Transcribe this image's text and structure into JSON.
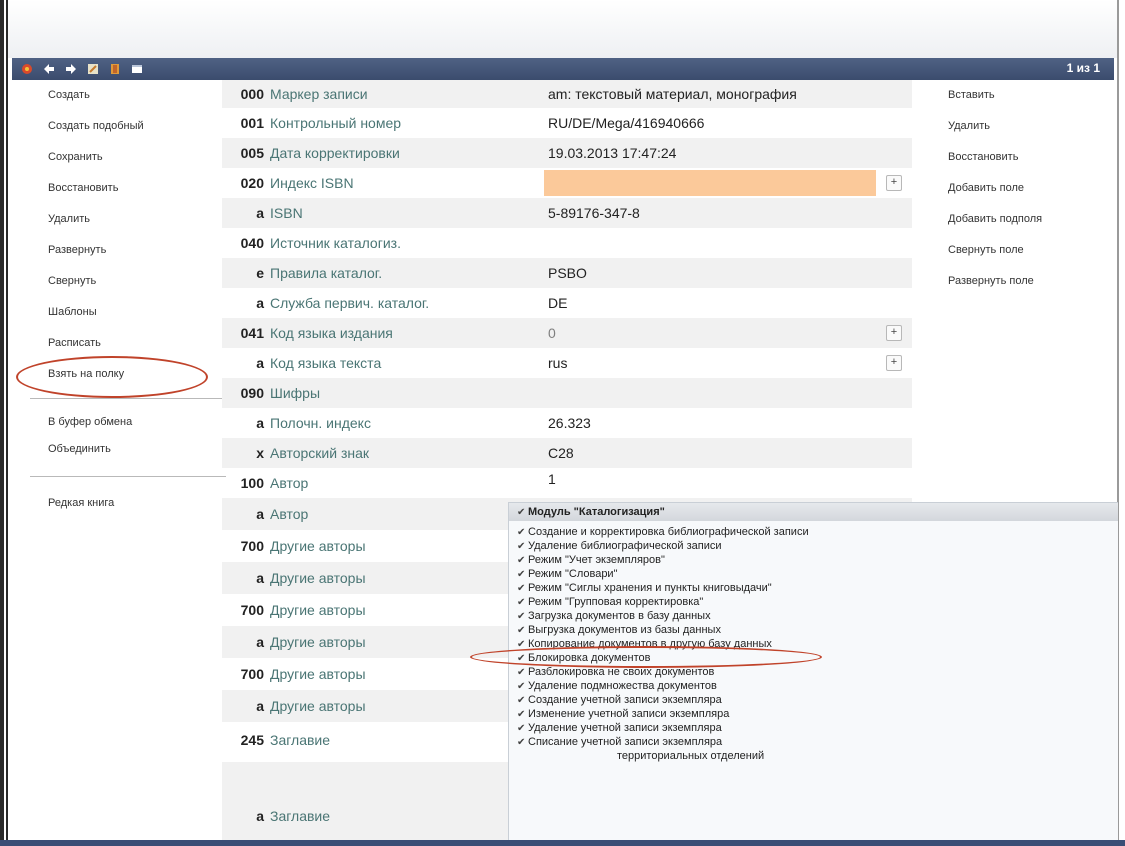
{
  "toolbar": {
    "icons": [
      "app-logo-icon",
      "arrow-left-icon",
      "arrow-right-icon",
      "edit-icon",
      "book-icon",
      "window-icon"
    ],
    "record_counter": "1 из 1"
  },
  "left_menu": {
    "items": [
      "Создать",
      "Создать подобный",
      "Сохранить",
      "Восстановить",
      "Удалить",
      "Развернуть",
      "Свернуть",
      "Шаблоны",
      "Расписать",
      "Взять на полку"
    ],
    "group2": [
      "В буфер обмена",
      "Объединить"
    ],
    "group3": [
      "Редкая книга"
    ]
  },
  "right_menu": {
    "items": [
      "Вставить",
      "Удалить",
      "Восстановить",
      "Добавить поле",
      "Добавить подполя",
      "Свернуть поле",
      "Развернуть поле"
    ]
  },
  "fields": [
    {
      "tag": "000",
      "label": "Маркер записи",
      "value": "am: текстовый материал, монография"
    },
    {
      "tag": "001",
      "label": "Контрольный номер",
      "value": "RU/DE/Mega/416940666"
    },
    {
      "tag": "005",
      "label": "Дата корректировки",
      "value": "19.03.2013 17:47:24"
    },
    {
      "tag": "020",
      "label": "Индекс ISBN",
      "value": ""
    },
    {
      "tag": "a",
      "label": "ISBN",
      "value": "5-89176-347-8"
    },
    {
      "tag": "040",
      "label": "Источник каталогиз.",
      "value": ""
    },
    {
      "tag": "e",
      "label": "Правила каталог.",
      "value": "PSBO"
    },
    {
      "tag": "a",
      "label": "Служба первич. каталог.",
      "value": "DE"
    },
    {
      "tag": "041",
      "label": "Код языка издания",
      "value": "0"
    },
    {
      "tag": "a",
      "label": "Код языка текста",
      "value": "rus"
    },
    {
      "tag": "090",
      "label": "Шифры",
      "value": ""
    },
    {
      "tag": "a",
      "label": "Полочн. индекс",
      "value": "26.323"
    },
    {
      "tag": "x",
      "label": "Авторский знак",
      "value": "C28"
    },
    {
      "tag": "100",
      "label": "Автор",
      "value": "1"
    },
    {
      "tag": "a",
      "label": "Автор",
      "value": ""
    },
    {
      "tag": "700",
      "label": "Другие авторы",
      "value": ""
    },
    {
      "tag": "a",
      "label": "Другие авторы",
      "value": ""
    },
    {
      "tag": "700",
      "label": "Другие авторы",
      "value": ""
    },
    {
      "tag": "a",
      "label": "Другие авторы",
      "value": ""
    },
    {
      "tag": "700",
      "label": "Другие авторы",
      "value": ""
    },
    {
      "tag": "a",
      "label": "Другие авторы",
      "value": ""
    },
    {
      "tag": "245",
      "label": "Заглавие",
      "value": ""
    },
    {
      "tag": "a",
      "label": "Заглавие",
      "value": ""
    }
  ],
  "permissions": {
    "header": "Модуль \"Каталогизация\"",
    "items": [
      "Создание и корректировка библиографической записи",
      "Удаление библиографической записи",
      "Режим \"Учет экземпляров\"",
      "Режим \"Словари\"",
      "Режим \"Сиглы хранения и пункты книговыдачи\"",
      "Режим \"Групповая корректировка\"",
      "Загрузка документов в базу данных",
      "Выгрузка документов из базы данных",
      "Копирование документов в другую базу данных",
      "Блокировка документов",
      "Разблокировка не своих документов",
      "Удаление подмножества документов",
      "Создание учетной записи экземпляра",
      "Изменение учетной записи экземпляра",
      "Удаление учетной записи экземпляра",
      "Списание учетной записи экземпляра",
      "территориальных отделений"
    ]
  },
  "colors": {
    "accent_header": "#3b4c6d",
    "highlight_field": "#fbc99a",
    "annotation": "#c0432a",
    "label_text": "#4a7574"
  }
}
